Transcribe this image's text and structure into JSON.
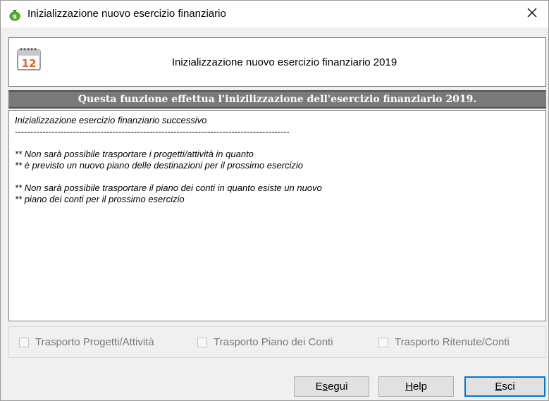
{
  "window": {
    "title": "Inizializzazione nuovo esercizio finanziario",
    "close_glyph": "✕"
  },
  "header": {
    "title": "Inizializzazione nuovo esercizio finanziario 2019",
    "icon": "calendar-icon",
    "icon_number": "12"
  },
  "banner": {
    "text": "Questa funzione effettua l'inizilizzazione dell'esercizio finanziario 2019."
  },
  "log": {
    "lines": [
      "Inizializzazione esercizio finanziario successivo",
      "------------------------------------------------------------------------------------------",
      "",
      "** Non sarà possibile trasportare i progetti/attività in quanto",
      "** è previsto un nuovo piano delle destinazioni per il prossimo esercizio",
      "",
      "** Non sarà possibile trasportare il piano dei conti in quanto esiste un nuovo",
      "** piano dei conti per il prossimo esercizio"
    ]
  },
  "options": [
    {
      "label": "Trasporto Progetti/Attività",
      "checked": false,
      "enabled": false
    },
    {
      "label": "Trasporto Piano dei Conti",
      "checked": false,
      "enabled": false
    },
    {
      "label": "Trasporto Ritenute/Conti",
      "checked": false,
      "enabled": false
    }
  ],
  "buttons": {
    "esegui": {
      "pre": "E",
      "mnemonic": "s",
      "post": "egui"
    },
    "help": {
      "pre": "",
      "mnemonic": "H",
      "post": "elp"
    },
    "esci": {
      "pre": "",
      "mnemonic": "E",
      "post": "sci"
    }
  },
  "colors": {
    "banner_bg": "#7a7a7a",
    "focus_border": "#0078d7",
    "disabled_text": "#7a7a7a"
  }
}
